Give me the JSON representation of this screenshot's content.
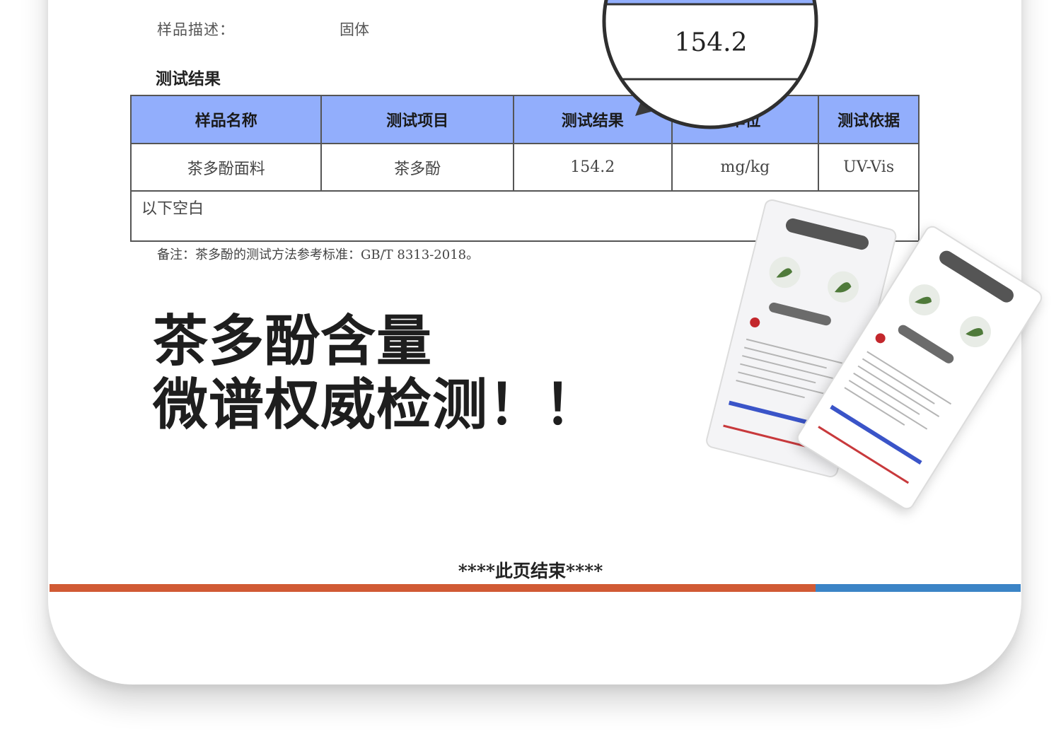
{
  "sample": {
    "description_label": "样品描述：",
    "description_value": "固体"
  },
  "results": {
    "title": "测试结果",
    "headers": [
      "样品名称",
      "测试项目",
      "测试结果",
      "单位",
      "测试依据"
    ],
    "row": [
      "茶多酚面料",
      "茶多酚",
      "154.2",
      "mg/kg",
      "UV-Vis"
    ],
    "blank_text": "以下空白"
  },
  "note": "备注：茶多酚的测试方法参考标准：GB/T 8313-2018。",
  "magnifier": {
    "value": "154.2"
  },
  "headline": {
    "line1": "茶多酚含量",
    "line2": "微谱权威检测！！"
  },
  "footer": {
    "end_text": "****此页结束****"
  },
  "colors": {
    "table_header": "#92aefc",
    "bar_orange": "#d15a34",
    "bar_blue": "#3b84c6"
  },
  "icons": [
    "leaf-icon",
    "brand-logo-icon"
  ]
}
